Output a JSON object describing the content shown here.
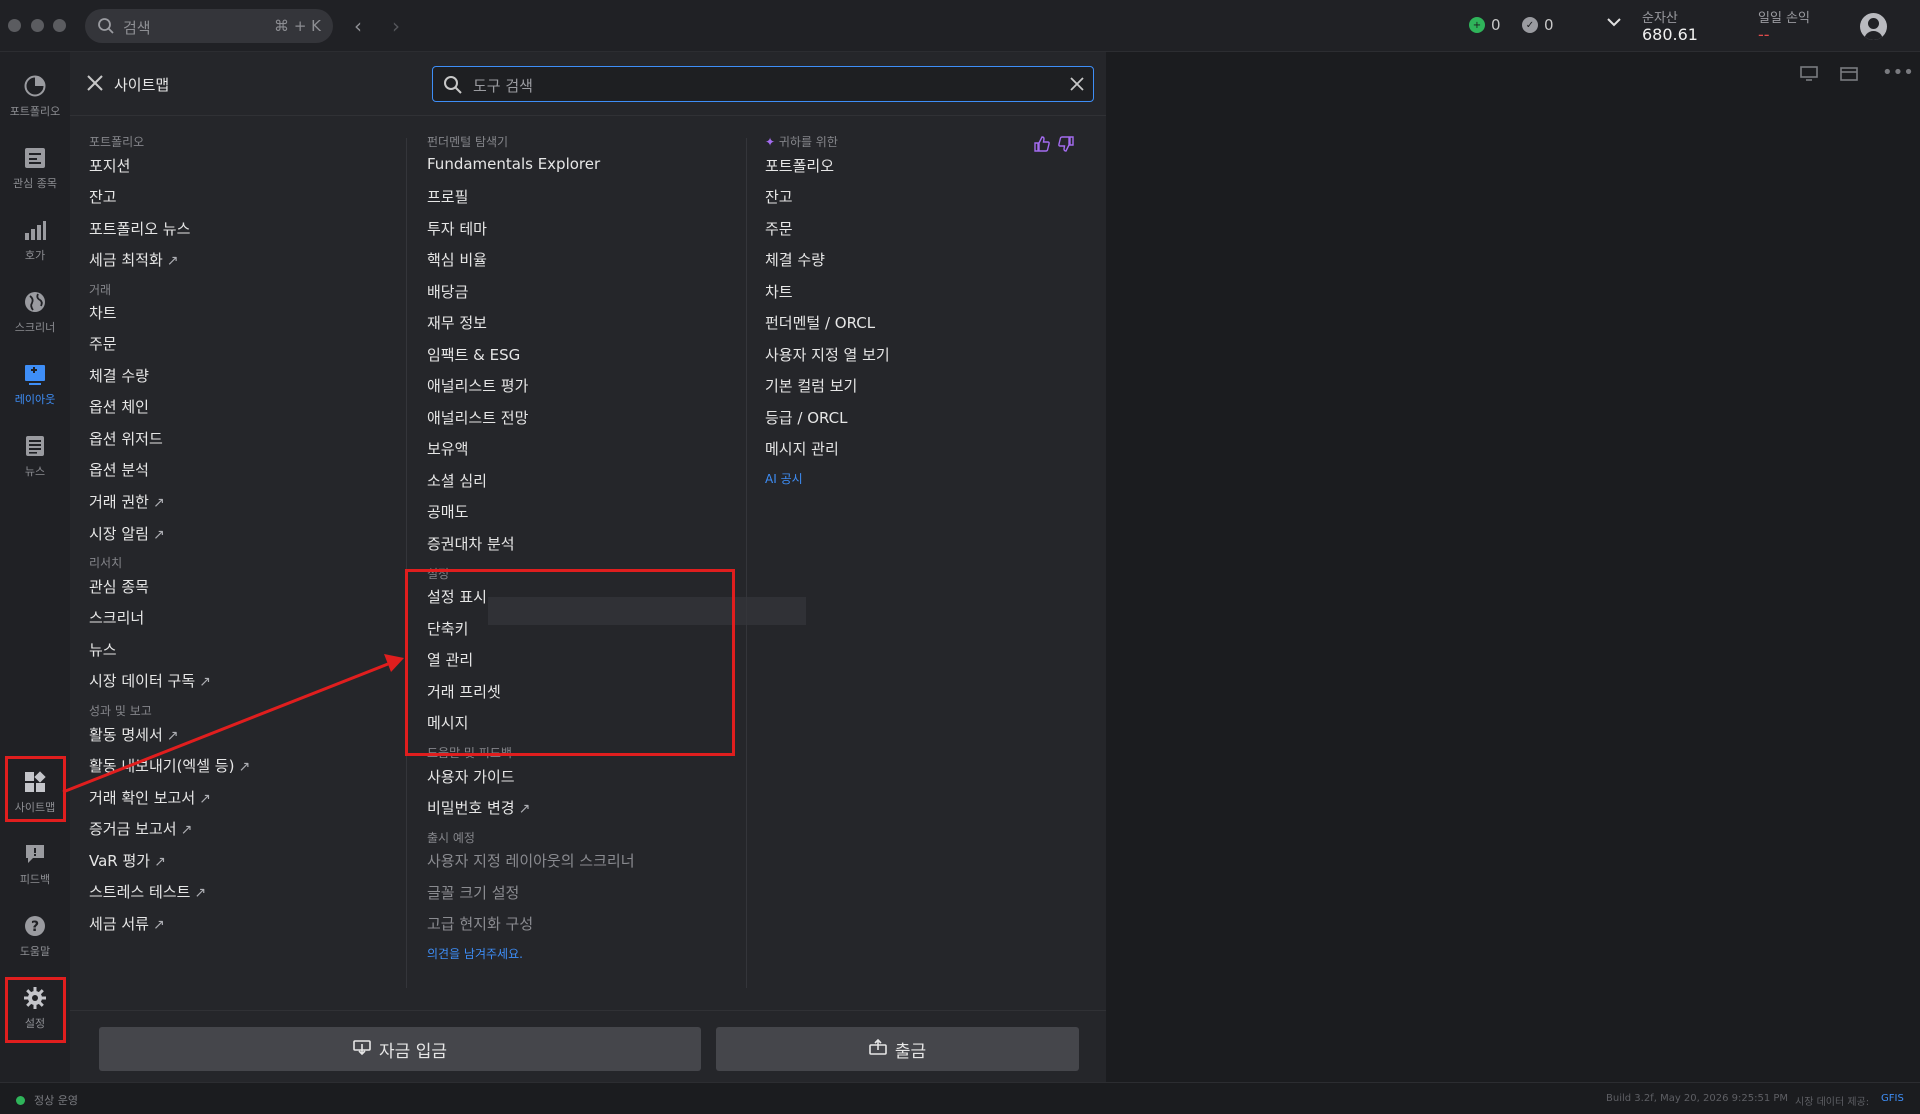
{
  "topbar": {
    "search_placeholder": "검색",
    "shortcut": "⌘ + K",
    "stat_green": "0",
    "stat_gray": "0",
    "net_assets_label": "순자산",
    "net_assets_value": "680.61",
    "daily_pl_label": "일일 손익",
    "daily_pl_value": "--"
  },
  "leftnav": [
    {
      "label": "포트폴리오",
      "icon": "portfolio-icon"
    },
    {
      "label": "관심 종목",
      "icon": "watchlist-icon"
    },
    {
      "label": "호가",
      "icon": "quote-icon"
    },
    {
      "label": "스크리너",
      "icon": "globe-icon"
    },
    {
      "label": "레이아웃",
      "icon": "layout-icon"
    },
    {
      "label": "뉴스",
      "icon": "news-icon"
    },
    {
      "label": "사이트맵",
      "icon": "sitemap-icon"
    },
    {
      "label": "피드백",
      "icon": "feedback-icon"
    },
    {
      "label": "도움말",
      "icon": "help-icon"
    },
    {
      "label": "설정",
      "icon": "gear-icon"
    }
  ],
  "panel": {
    "title": "사이트맵",
    "search_placeholder": "도구 검색"
  },
  "col1": {
    "portfolio_header": "포트폴리오",
    "positions": "포지션",
    "balance": "잔고",
    "portfolio_news": "포트폴리오 뉴스",
    "tax_opt": "세금 최적화",
    "trade_header": "거래",
    "chart": "차트",
    "order": "주문",
    "fills": "체결 수량",
    "option_chain": "옵션 체인",
    "option_wizard": "옵션 위저드",
    "option_analysis": "옵션 분석",
    "trading_perm": "거래 권한",
    "market_alerts": "시장 알림",
    "research_header": "리서치",
    "watchlist": "관심 종목",
    "screener": "스크리너",
    "news": "뉴스",
    "mkt_data_sub": "시장 데이터 구독",
    "perf_header": "성과 및 보고",
    "activity_stmt": "활동 명세서",
    "activity_export": "활동 내보내기(엑셀 등)",
    "trade_confirm": "거래 확인 보고서",
    "margin_report": "증거금 보고서",
    "var": "VaR 평가",
    "stress": "스트레스 테스트",
    "tax_docs": "세금 서류"
  },
  "col2": {
    "fund_header": "펀더멘털 탐색기",
    "fund_explorer": "Fundamentals Explorer",
    "profile": "프로필",
    "theme": "투자 테마",
    "key_ratios": "핵심 비율",
    "dividend": "배당금",
    "financials": "재무 정보",
    "impact": "임팩트 & ESG",
    "analyst_rating": "애널리스트 평가",
    "analyst_outlook": "애널리스트 전망",
    "ownership": "보유액",
    "social": "소셜 심리",
    "short": "공매도",
    "sec_lending": "증권대차 분석",
    "settings_header": "설정",
    "display_settings": "설정 표시",
    "hotkeys": "단축키",
    "columns": "열 관리",
    "trade_presets": "거래 프리셋",
    "messages": "메시지",
    "help_header": "도움말 및 피드백",
    "user_guide": "사용자 가이드",
    "change_pw": "비밀번호 변경",
    "coming_header": "출시 예정",
    "custom_screener": "사용자 지정 레이아웃의 스크리너",
    "font_size": "글꼴 크기 설정",
    "localization": "고급 현지화 구성",
    "leave_feedback": "의견을 남겨주세요."
  },
  "col3": {
    "for_you_header": "귀하를 위한",
    "portfolio": "포트폴리오",
    "balance": "잔고",
    "order": "주문",
    "fills": "체결 수량",
    "chart": "차트",
    "fund_orcl": "펀더멘털 / ORCL",
    "custom_cols": "사용자 지정 열 보기",
    "basic_cols": "기본 컬럼 보기",
    "rating_orcl": "등급 / ORCL",
    "msg_mgmt": "메시지 관리",
    "ai_disclosure": "AI 공시"
  },
  "buttons": {
    "deposit": "자금 입금",
    "withdraw": "출금"
  },
  "status": {
    "state": "정상 운영",
    "build": "Build 3.2f, May 20, 2026 9:25:51 PM",
    "market_data": "시장 데이터 제공:",
    "provider": "GFIS"
  },
  "colors": {
    "accent": "#3e8ef7",
    "annotation_red": "#e01e1e",
    "positive_green": "#2fb45a"
  }
}
